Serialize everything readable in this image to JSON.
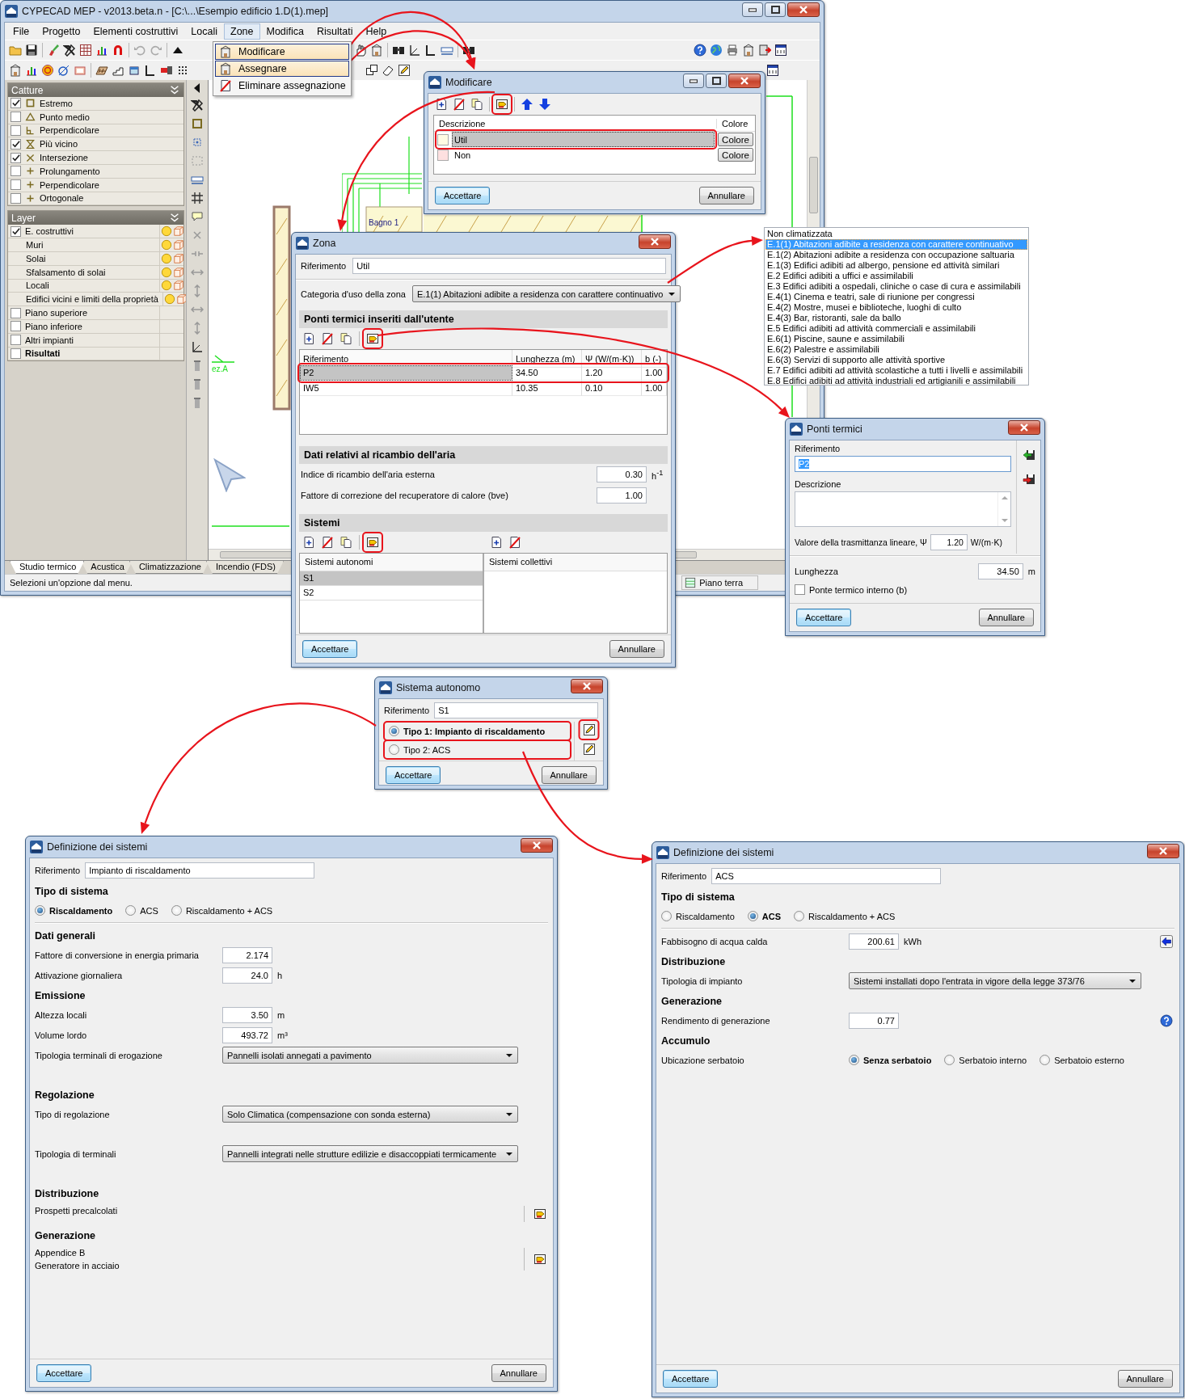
{
  "main_window": {
    "title": "CYPECAD MEP - v2013.beta.n - [C:\\...\\Esempio edificio 1.D(1).mep]",
    "menu": [
      {
        "label": "File",
        "selected": false
      },
      {
        "label": "Progetto",
        "selected": false
      },
      {
        "label": "Elementi costruttivi",
        "selected": false
      },
      {
        "label": "Locali",
        "selected": false
      },
      {
        "label": "Zone",
        "selected": true
      },
      {
        "label": "Modifica",
        "selected": false
      },
      {
        "label": "Risultati",
        "selected": false
      },
      {
        "label": "Help",
        "selected": false
      }
    ],
    "zone_menu": [
      {
        "label": "Modificare",
        "selected": true
      },
      {
        "label": "Assegnare",
        "selected": true
      },
      {
        "label": "Eliminare assegnazione",
        "selected": false
      }
    ],
    "snaps": {
      "title": "Catture",
      "items": [
        {
          "label": "Estremo",
          "checked": true
        },
        {
          "label": "Punto medio",
          "checked": false
        },
        {
          "label": "Perpendicolare",
          "checked": false
        },
        {
          "label": "Più vicino",
          "checked": true
        },
        {
          "label": "Intersezione",
          "checked": true
        },
        {
          "label": "Prolungamento",
          "checked": false
        },
        {
          "label": "Perpendicolare",
          "checked": false
        },
        {
          "label": "Ortogonale",
          "checked": false
        }
      ]
    },
    "layers": {
      "title": "Layer",
      "items": [
        {
          "label": "E. costruttivi",
          "checked": true,
          "kind": "layer",
          "children": [
            {
              "label": "Muri",
              "kind": "layer"
            },
            {
              "label": "Solai",
              "kind": "layer"
            },
            {
              "label": "Sfalsamento di solai",
              "kind": "layer"
            },
            {
              "label": "Locali",
              "kind": "layer"
            },
            {
              "label": "Edifici vicini e limiti della proprietà",
              "kind": "layer"
            }
          ]
        },
        {
          "label": "Piano superiore",
          "checked": false,
          "kind": "plain"
        },
        {
          "label": "Piano inferiore",
          "checked": false,
          "kind": "plain"
        },
        {
          "label": "Altri impianti",
          "checked": false,
          "kind": "plain"
        },
        {
          "label": "Risultati",
          "checked": false,
          "kind": "summary"
        }
      ]
    },
    "drawing_labels": [
      "Bagno 1",
      "ez.A"
    ],
    "tabs": [
      {
        "label": "Studio termico",
        "selected": true
      },
      {
        "label": "Acustica",
        "selected": false
      },
      {
        "label": "Climatizzazione",
        "selected": false
      },
      {
        "label": "Incendio (FDS)",
        "selected": false
      }
    ],
    "status_bar": {
      "message": "Selezioni un'opzione dal menu.",
      "floor": "Piano terra"
    }
  },
  "modify_dialog": {
    "title": "Modificare",
    "columns": [
      "Descrizione",
      "Colore"
    ],
    "rows": [
      {
        "description": "Util",
        "color": "#fffbe3",
        "button": "Colore",
        "selected": true
      },
      {
        "description": "Non",
        "color": "#fde0e0",
        "button": "Colore",
        "selected": false
      }
    ],
    "buttons": [
      "Accettare",
      "Annullare"
    ]
  },
  "zone_dialog": {
    "title": "Zona",
    "reference_label": "Riferimento",
    "reference": "Util",
    "category_label": "Categoria d'uso della zona",
    "category": "E.1(1) Abitazioni adibite a residenza con carattere continuativo",
    "thermal_bridges": {
      "title": "Ponti termici inseriti dall'utente",
      "columns": [
        "Riferimento",
        "Lunghezza (m)",
        "Ψ (W/(m·K))",
        "b (-)"
      ],
      "rows": [
        {
          "cells": [
            "P2",
            "34.50",
            "1.20",
            "1.00"
          ],
          "selected": true
        },
        {
          "cells": [
            "IW5",
            "10.35",
            "0.10",
            "1.00"
          ],
          "selected": false
        }
      ]
    },
    "air": {
      "title": "Dati relativi al ricambio dell'aria",
      "fields": [
        {
          "label": "Indice di ricambio dell'aria esterna",
          "value": "0.30",
          "unit": "h$^{-1}$"
        },
        {
          "label": "Fattore di correzione del recuperatore di calore (bve)",
          "value": "1.00"
        }
      ]
    },
    "systems": {
      "title": "Sistemi",
      "autonomous": {
        "heading": "Sistemi autonomi",
        "items": [
          {
            "label": "S1",
            "selected": true
          },
          {
            "label": "S2",
            "selected": false
          }
        ]
      },
      "collective": {
        "heading": "Sistemi collettivi"
      }
    },
    "buttons": [
      "Accettare",
      "Annullare"
    ]
  },
  "category_list": {
    "items": [
      {
        "label": "Non climatizzata",
        "selected": false
      },
      {
        "label": "E.1(1) Abitazioni adibite a residenza con carattere continuativo",
        "selected": true
      },
      {
        "label": "E.1(2) Abitazioni adibite a residenza con occupazione saltuaria",
        "selected": false
      },
      {
        "label": "E.1(3) Edifici adibiti ad albergo, pensione ed attività similari",
        "selected": false
      },
      {
        "label": "E.2 Edifici adibiti a uffici e assimilabili",
        "selected": false
      },
      {
        "label": "E.3 Edifici adibiti a ospedali, cliniche o case di cura e assimilabili",
        "selected": false
      },
      {
        "label": "E.4(1) Cinema e teatri, sale di riunione per congressi",
        "selected": false
      },
      {
        "label": "E.4(2) Mostre, musei e biblioteche, luoghi di culto",
        "selected": false
      },
      {
        "label": "E.4(3) Bar, ristoranti, sale da ballo",
        "selected": false
      },
      {
        "label": "E.5 Edifici adibiti ad attività commerciali e assimilabili",
        "selected": false
      },
      {
        "label": "E.6(1) Piscine, saune e assimilabili",
        "selected": false
      },
      {
        "label": "E.6(2) Palestre e assimilabili",
        "selected": false
      },
      {
        "label": "E.6(3) Servizi di supporto alle attività sportive",
        "selected": false
      },
      {
        "label": "E.7 Edifici adibiti ad attività scolastiche a tutti i livelli e assimilabili",
        "selected": false
      },
      {
        "label": "E.8 Edifici adibiti ad attività industriali ed artigianili e assimilabili",
        "selected": false
      }
    ]
  },
  "bridge_dialog": {
    "title": "Ponti termici",
    "reference_label": "Riferimento",
    "reference": "P2",
    "reference_selected": true,
    "description_label": "Descrizione",
    "psi_label": "Valore della trasmittanza lineare, Ψ",
    "psi": "1.20",
    "psi_unit": "W/(m·K)",
    "length_label": "Lunghezza",
    "length": "34.50",
    "length_unit": "m",
    "internal": {
      "label": "Ponte termico interno (b)",
      "checked": false
    },
    "buttons": [
      "Accettare",
      "Annullare"
    ]
  },
  "system_dialog": {
    "title": "Sistema autonomo",
    "reference_label": "Riferimento",
    "reference": "S1",
    "types": [
      {
        "label": "Tipo 1: Impianto di riscaldamento",
        "selected": true
      },
      {
        "label": "Tipo 2: ACS",
        "selected": false
      }
    ],
    "buttons": [
      "Accettare",
      "Annullare"
    ]
  },
  "definition_dialogs": [
    {
      "title": "Definizione dei sistemi",
      "reference_label": "Riferimento",
      "reference": "Impianto di riscaldamento",
      "rows": [
        {
          "kind": "heading",
          "label": "Tipo di sistema"
        },
        {
          "kind": "radios",
          "options": [
            {
              "label": "Riscaldamento",
              "selected": true
            },
            {
              "label": "ACS",
              "selected": false
            },
            {
              "label": "Riscaldamento + ACS",
              "selected": false
            }
          ]
        },
        {
          "kind": "heading",
          "label": "Dati generali"
        },
        {
          "kind": "number",
          "label": "Fattore di conversione in energia primaria",
          "value": "2.174"
        },
        {
          "kind": "number",
          "label": "Attivazione giornaliera",
          "value": "24.0",
          "unit": "h"
        },
        {
          "kind": "heading",
          "label": "Emissione"
        },
        {
          "kind": "number",
          "label": "Altezza locali",
          "value": "3.50",
          "unit": "m"
        },
        {
          "kind": "number",
          "label": "Volume lordo",
          "value": "493.72",
          "unit": "m³"
        },
        {
          "kind": "select",
          "label": "Tipologia terminali di erogazione",
          "value": "Pannelli isolati annegati a pavimento"
        },
        {
          "kind": "heading",
          "label": "Regolazione"
        },
        {
          "kind": "select",
          "label": "Tipo di regolazione",
          "value": "Solo Climatica (compensazione con sonda esterna)"
        },
        {
          "kind": "select",
          "label": "Tipologia di terminali",
          "value": "Pannelli integrati nelle strutture edilizie e disaccoppiati termicamente"
        },
        {
          "kind": "heading",
          "label": "Distribuzione"
        },
        {
          "kind": "action",
          "lines": [
            "Prospetti precalcolati"
          ]
        },
        {
          "kind": "heading",
          "label": "Generazione"
        },
        {
          "kind": "action",
          "lines": [
            "Appendice B",
            "Generatore in acciaio"
          ]
        }
      ],
      "buttons": [
        "Accettare",
        "Annullare"
      ]
    },
    {
      "title": "Definizione dei sistemi",
      "reference_label": "Riferimento",
      "reference": "ACS",
      "rows": [
        {
          "kind": "heading",
          "label": "Tipo di sistema"
        },
        {
          "kind": "radios",
          "options": [
            {
              "label": "Riscaldamento",
              "selected": false
            },
            {
              "label": "ACS",
              "selected": true
            },
            {
              "label": "Riscaldamento + ACS",
              "selected": false
            }
          ]
        },
        {
          "kind": "linked",
          "label": "Fabbisogno di acqua calda",
          "value": "200.61",
          "unit": "kWh"
        },
        {
          "kind": "heading",
          "label": "Distribuzione"
        },
        {
          "kind": "select",
          "label": "Tipologia di impianto",
          "value": "Sistemi installati dopo l'entrata in vigore della legge 373/76"
        },
        {
          "kind": "heading",
          "label": "Generazione"
        },
        {
          "kind": "assisted",
          "label": "Rendimento di generazione",
          "value": "0.77"
        },
        {
          "kind": "heading",
          "label": "Accumulo"
        },
        {
          "kind": "radios",
          "label": "Ubicazione serbatoio",
          "options": [
            {
              "label": "Senza serbatoio",
              "selected": true
            },
            {
              "label": "Serbatoio interno",
              "selected": false
            },
            {
              "label": "Serbatoio esterno",
              "selected": false
            }
          ]
        }
      ],
      "buttons": [
        "Accettare",
        "Annullare"
      ]
    }
  ]
}
